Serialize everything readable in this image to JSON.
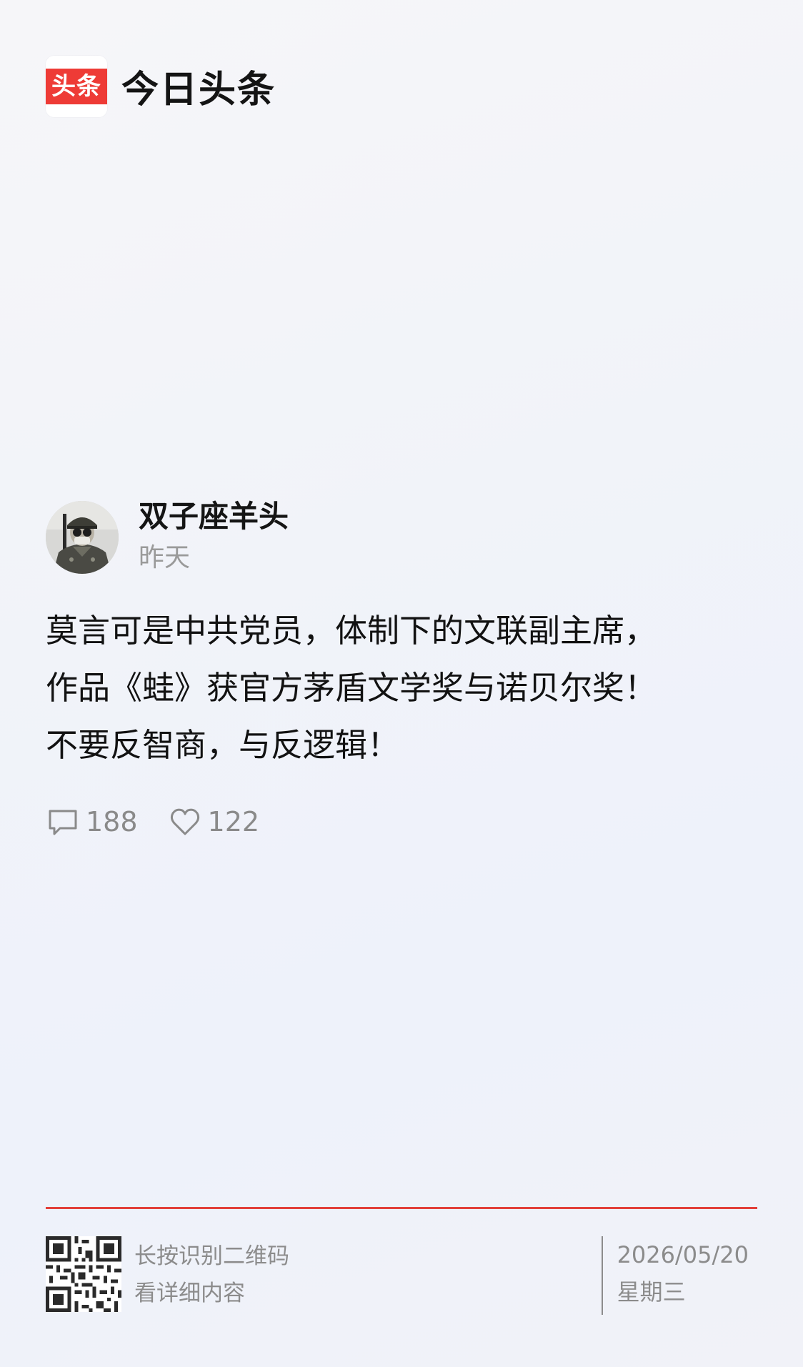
{
  "brand": {
    "logo_text": "头条",
    "name": "今日头条",
    "logo_color": "#ee3b36"
  },
  "author": {
    "name": "双子座羊头",
    "time": "昨天",
    "avatar_icon": "avatar-photo"
  },
  "post": {
    "lines": [
      "莫言可是中共党员，体制下的文联副主席，",
      "作品《蛙》获官方茅盾文学奖与诺贝尔奖！",
      "不要反智商，与反逻辑！"
    ]
  },
  "stats": {
    "comments": "188",
    "likes": "122",
    "comment_icon": "comment-icon",
    "like_icon": "heart-icon"
  },
  "footer": {
    "qr_line1": "长按识别二维码",
    "qr_line2": "看详细内容",
    "date": "2026/05/20",
    "weekday": "星期三",
    "divider_color": "#e2403a"
  }
}
